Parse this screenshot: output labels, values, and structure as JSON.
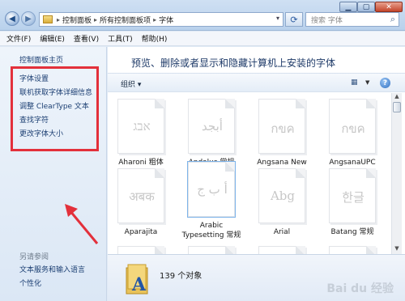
{
  "address": {
    "crumbs": [
      "控制面板",
      "所有控制面板项",
      "字体"
    ],
    "search_placeholder": "搜索 字体"
  },
  "menu": [
    "文件(F)",
    "编辑(E)",
    "查看(V)",
    "工具(T)",
    "帮助(H)"
  ],
  "sidebar": {
    "home": "控制面板主页",
    "tasks": [
      "字体设置",
      "联机获取字体详细信息",
      "调整 ClearType 文本",
      "查找字符",
      "更改字体大小"
    ],
    "see_also_title": "另请参阅",
    "see_also": [
      "文本服务和输入语言",
      "个性化"
    ]
  },
  "main": {
    "title": "预览、删除或者显示和隐藏计算机上安装的字体",
    "organize_label": "组织 ▾",
    "fonts": [
      {
        "name": "Aharoni 粗体",
        "sample": "אבג"
      },
      {
        "name": "Andalus 常规",
        "sample": "أبجد"
      },
      {
        "name": "Angsana New",
        "sample": "กขค"
      },
      {
        "name": "AngsanaUPC",
        "sample": "กขค"
      },
      {
        "name": "Aparajita",
        "sample": "अबक"
      },
      {
        "name": "Arabic Typesetting 常规",
        "sample": "أ ب ج"
      },
      {
        "name": "Arial",
        "sample": "Abg"
      },
      {
        "name": "Batang 常规",
        "sample": "한글"
      }
    ]
  },
  "status": {
    "count": "139 个对象"
  },
  "watermark": "Bai du 经验",
  "colors": {
    "highlight_box": "#e3303b",
    "link": "#1c3f73"
  }
}
